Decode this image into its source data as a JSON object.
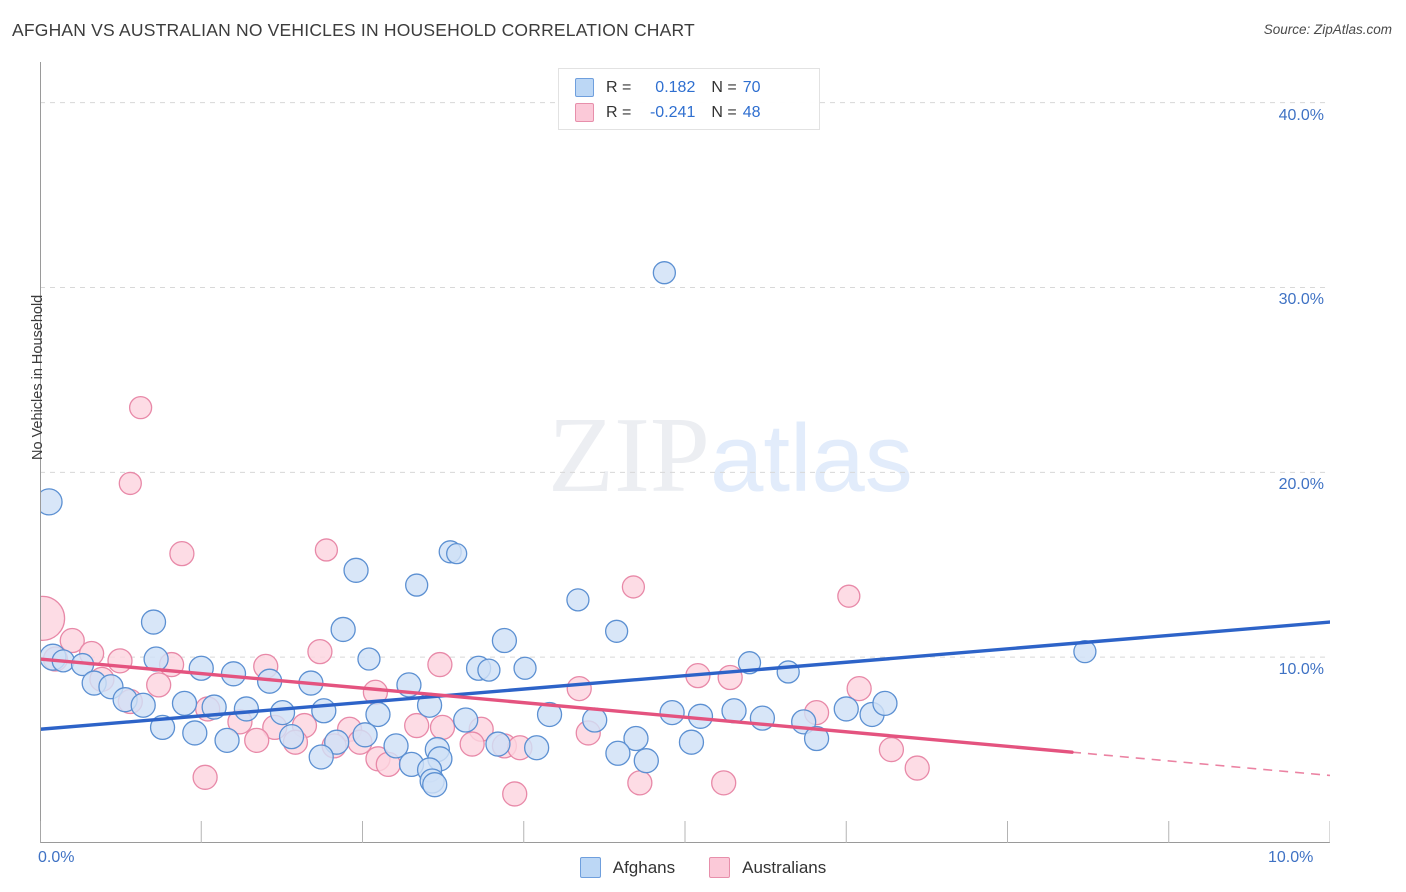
{
  "header": {
    "title": "AFGHAN VS AUSTRALIAN NO VEHICLES IN HOUSEHOLD CORRELATION CHART",
    "source": "Source: ZipAtlas.com"
  },
  "watermark": {
    "part1": "ZIP",
    "part2": "atlas"
  },
  "r_legend": {
    "rows": [
      {
        "series": "Afghans",
        "r_label": "R =",
        "r_value": "0.182",
        "n_label": "N =",
        "n_value": "70",
        "color": "#bcd7f5"
      },
      {
        "series": "Australians",
        "r_label": "R =",
        "r_value": "-0.241",
        "n_label": "N =",
        "n_value": "48",
        "color": "#fbc9d8"
      }
    ]
  },
  "series_legend": [
    {
      "label": "Afghans",
      "color": "#bcd7f5"
    },
    {
      "label": "Australians",
      "color": "#fbc9d8"
    }
  ],
  "chart_data": {
    "type": "scatter",
    "title": "AFGHAN VS AUSTRALIAN NO VEHICLES IN HOUSEHOLD CORRELATION CHART",
    "xlabel": "",
    "ylabel": "No Vehicles in Household",
    "xlim": [
      0.0,
      10.0
    ],
    "ylim": [
      0.0,
      42.2
    ],
    "x_unit": "%",
    "y_unit": "%",
    "grid": "horizontal-dashed",
    "legend_position": "bottom-center",
    "xticks": [
      {
        "value": 0.0,
        "label": "0.0%"
      },
      {
        "value": 1.25,
        "label": ""
      },
      {
        "value": 2.5,
        "label": ""
      },
      {
        "value": 3.75,
        "label": ""
      },
      {
        "value": 5.0,
        "label": ""
      },
      {
        "value": 6.25,
        "label": ""
      },
      {
        "value": 7.5,
        "label": ""
      },
      {
        "value": 8.75,
        "label": ""
      },
      {
        "value": 10.0,
        "label": "10.0%"
      }
    ],
    "yticks": [
      {
        "value": 10.0,
        "label": "10.0%"
      },
      {
        "value": 20.0,
        "label": "20.0%"
      },
      {
        "value": 30.0,
        "label": "30.0%"
      },
      {
        "value": 40.0,
        "label": "40.0%"
      }
    ],
    "series": [
      {
        "name": "Afghans",
        "r": 0.182,
        "n": 70,
        "fill": "#cfe0f7",
        "stroke": "#5c90d2",
        "trend": {
          "x0": 0.0,
          "y0": 6.1,
          "x1": 10.0,
          "y1": 11.9,
          "solid_to": 10.0
        },
        "points": [
          {
            "x": 0.07,
            "y": 18.4,
            "r": 13
          },
          {
            "x": 4.84,
            "y": 30.8,
            "r": 11
          },
          {
            "x": 3.18,
            "y": 15.7,
            "r": 11
          },
          {
            "x": 3.23,
            "y": 15.6,
            "r": 10
          },
          {
            "x": 2.45,
            "y": 14.7,
            "r": 12
          },
          {
            "x": 2.92,
            "y": 13.9,
            "r": 11
          },
          {
            "x": 4.17,
            "y": 13.1,
            "r": 11
          },
          {
            "x": 0.88,
            "y": 11.9,
            "r": 12
          },
          {
            "x": 4.47,
            "y": 11.4,
            "r": 11
          },
          {
            "x": 2.35,
            "y": 11.5,
            "r": 12
          },
          {
            "x": 3.6,
            "y": 10.9,
            "r": 12
          },
          {
            "x": 8.1,
            "y": 10.3,
            "r": 11
          },
          {
            "x": 5.5,
            "y": 9.7,
            "r": 11
          },
          {
            "x": 3.76,
            "y": 9.4,
            "r": 11
          },
          {
            "x": 5.8,
            "y": 9.2,
            "r": 11
          },
          {
            "x": 0.1,
            "y": 10.0,
            "r": 13
          },
          {
            "x": 0.18,
            "y": 9.8,
            "r": 11
          },
          {
            "x": 0.33,
            "y": 9.6,
            "r": 11
          },
          {
            "x": 0.9,
            "y": 9.9,
            "r": 12
          },
          {
            "x": 2.55,
            "y": 9.9,
            "r": 11
          },
          {
            "x": 3.4,
            "y": 9.4,
            "r": 12
          },
          {
            "x": 3.48,
            "y": 9.3,
            "r": 11
          },
          {
            "x": 1.25,
            "y": 9.4,
            "r": 12
          },
          {
            "x": 1.5,
            "y": 9.1,
            "r": 12
          },
          {
            "x": 0.42,
            "y": 8.6,
            "r": 12
          },
          {
            "x": 0.55,
            "y": 8.4,
            "r": 12
          },
          {
            "x": 1.78,
            "y": 8.7,
            "r": 12
          },
          {
            "x": 2.1,
            "y": 8.6,
            "r": 12
          },
          {
            "x": 2.86,
            "y": 8.5,
            "r": 12
          },
          {
            "x": 0.66,
            "y": 7.7,
            "r": 12
          },
          {
            "x": 0.8,
            "y": 7.4,
            "r": 12
          },
          {
            "x": 1.12,
            "y": 7.5,
            "r": 12
          },
          {
            "x": 1.35,
            "y": 7.3,
            "r": 12
          },
          {
            "x": 1.6,
            "y": 7.2,
            "r": 12
          },
          {
            "x": 1.88,
            "y": 7.0,
            "r": 12
          },
          {
            "x": 2.2,
            "y": 7.1,
            "r": 12
          },
          {
            "x": 2.62,
            "y": 6.9,
            "r": 12
          },
          {
            "x": 3.02,
            "y": 7.4,
            "r": 12
          },
          {
            "x": 3.3,
            "y": 6.6,
            "r": 12
          },
          {
            "x": 3.95,
            "y": 6.9,
            "r": 12
          },
          {
            "x": 4.3,
            "y": 6.6,
            "r": 12
          },
          {
            "x": 4.9,
            "y": 7.0,
            "r": 12
          },
          {
            "x": 5.12,
            "y": 6.8,
            "r": 12
          },
          {
            "x": 5.38,
            "y": 7.1,
            "r": 12
          },
          {
            "x": 5.6,
            "y": 6.7,
            "r": 12
          },
          {
            "x": 5.92,
            "y": 6.5,
            "r": 12
          },
          {
            "x": 6.25,
            "y": 7.2,
            "r": 12
          },
          {
            "x": 6.45,
            "y": 6.9,
            "r": 12
          },
          {
            "x": 6.55,
            "y": 7.5,
            "r": 12
          },
          {
            "x": 0.95,
            "y": 6.2,
            "r": 12
          },
          {
            "x": 1.2,
            "y": 5.9,
            "r": 12
          },
          {
            "x": 1.45,
            "y": 5.5,
            "r": 12
          },
          {
            "x": 1.95,
            "y": 5.7,
            "r": 12
          },
          {
            "x": 2.3,
            "y": 5.4,
            "r": 12
          },
          {
            "x": 2.52,
            "y": 5.8,
            "r": 12
          },
          {
            "x": 2.76,
            "y": 5.2,
            "r": 12
          },
          {
            "x": 3.08,
            "y": 5.0,
            "r": 12
          },
          {
            "x": 3.55,
            "y": 5.3,
            "r": 12
          },
          {
            "x": 3.85,
            "y": 5.1,
            "r": 12
          },
          {
            "x": 4.62,
            "y": 5.6,
            "r": 12
          },
          {
            "x": 5.05,
            "y": 5.4,
            "r": 12
          },
          {
            "x": 6.02,
            "y": 5.6,
            "r": 12
          },
          {
            "x": 4.48,
            "y": 4.8,
            "r": 12
          },
          {
            "x": 4.7,
            "y": 4.4,
            "r": 12
          },
          {
            "x": 3.1,
            "y": 4.5,
            "r": 12
          },
          {
            "x": 2.18,
            "y": 4.6,
            "r": 12
          },
          {
            "x": 2.88,
            "y": 4.2,
            "r": 12
          },
          {
            "x": 3.02,
            "y": 3.9,
            "r": 12
          },
          {
            "x": 3.04,
            "y": 3.3,
            "r": 12
          },
          {
            "x": 3.06,
            "y": 3.1,
            "r": 12
          }
        ]
      },
      {
        "name": "Australians",
        "r": -0.241,
        "n": 48,
        "fill": "#fcd4df",
        "stroke": "#e889a8",
        "trend": {
          "x0": 0.0,
          "y0": 9.9,
          "x1": 10.0,
          "y1": 3.6,
          "solid_to": 8.0
        },
        "points": [
          {
            "x": 0.78,
            "y": 23.5,
            "r": 11
          },
          {
            "x": 0.7,
            "y": 19.4,
            "r": 11
          },
          {
            "x": 1.1,
            "y": 15.6,
            "r": 12
          },
          {
            "x": 2.22,
            "y": 15.8,
            "r": 11
          },
          {
            "x": 4.6,
            "y": 13.8,
            "r": 11
          },
          {
            "x": 6.27,
            "y": 13.3,
            "r": 11
          },
          {
            "x": 0.02,
            "y": 12.1,
            "r": 22
          },
          {
            "x": 0.25,
            "y": 10.9,
            "r": 12
          },
          {
            "x": 0.4,
            "y": 10.2,
            "r": 12
          },
          {
            "x": 2.17,
            "y": 10.3,
            "r": 12
          },
          {
            "x": 3.1,
            "y": 9.6,
            "r": 12
          },
          {
            "x": 0.12,
            "y": 9.9,
            "r": 12
          },
          {
            "x": 0.62,
            "y": 9.8,
            "r": 12
          },
          {
            "x": 1.02,
            "y": 9.6,
            "r": 12
          },
          {
            "x": 1.75,
            "y": 9.5,
            "r": 12
          },
          {
            "x": 5.1,
            "y": 9.0,
            "r": 12
          },
          {
            "x": 5.35,
            "y": 8.9,
            "r": 12
          },
          {
            "x": 4.18,
            "y": 8.3,
            "r": 12
          },
          {
            "x": 6.35,
            "y": 8.3,
            "r": 12
          },
          {
            "x": 0.48,
            "y": 8.8,
            "r": 12
          },
          {
            "x": 0.92,
            "y": 8.5,
            "r": 12
          },
          {
            "x": 2.6,
            "y": 8.1,
            "r": 12
          },
          {
            "x": 6.02,
            "y": 7.0,
            "r": 12
          },
          {
            "x": 0.7,
            "y": 7.6,
            "r": 12
          },
          {
            "x": 1.3,
            "y": 7.2,
            "r": 12
          },
          {
            "x": 1.55,
            "y": 6.5,
            "r": 12
          },
          {
            "x": 1.82,
            "y": 6.2,
            "r": 12
          },
          {
            "x": 2.05,
            "y": 6.3,
            "r": 12
          },
          {
            "x": 2.4,
            "y": 6.1,
            "r": 12
          },
          {
            "x": 2.92,
            "y": 6.3,
            "r": 12
          },
          {
            "x": 3.12,
            "y": 6.2,
            "r": 12
          },
          {
            "x": 3.42,
            "y": 6.1,
            "r": 12
          },
          {
            "x": 4.25,
            "y": 5.9,
            "r": 12
          },
          {
            "x": 1.68,
            "y": 5.5,
            "r": 12
          },
          {
            "x": 1.98,
            "y": 5.4,
            "r": 12
          },
          {
            "x": 2.28,
            "y": 5.2,
            "r": 12
          },
          {
            "x": 2.48,
            "y": 5.4,
            "r": 12
          },
          {
            "x": 3.35,
            "y": 5.3,
            "r": 12
          },
          {
            "x": 3.6,
            "y": 5.2,
            "r": 12
          },
          {
            "x": 3.72,
            "y": 5.1,
            "r": 12
          },
          {
            "x": 6.6,
            "y": 5.0,
            "r": 12
          },
          {
            "x": 2.62,
            "y": 4.5,
            "r": 12
          },
          {
            "x": 2.7,
            "y": 4.2,
            "r": 12
          },
          {
            "x": 1.28,
            "y": 3.5,
            "r": 12
          },
          {
            "x": 4.65,
            "y": 3.2,
            "r": 12
          },
          {
            "x": 5.3,
            "y": 3.2,
            "r": 12
          },
          {
            "x": 3.68,
            "y": 2.6,
            "r": 12
          },
          {
            "x": 6.8,
            "y": 4.0,
            "r": 12
          }
        ]
      }
    ]
  }
}
